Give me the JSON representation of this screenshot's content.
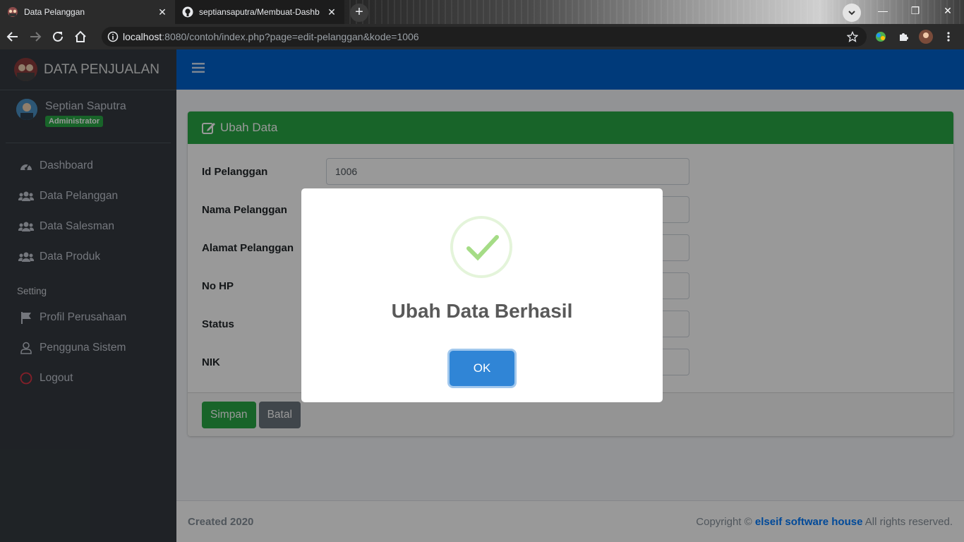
{
  "browser": {
    "tabs": [
      {
        "title": "Data Pelanggan",
        "active": true
      },
      {
        "title": "septiansaputra/Membuat-Dashb",
        "active": false
      }
    ],
    "url_host": "localhost",
    "url_rest": ":8080/contoh/index.php?page=edit-pelanggan&kode=1006"
  },
  "sidebar": {
    "brand": "DATA PENJUALAN",
    "user_name": "Septian Saputra",
    "user_role": "Administrator",
    "items": [
      {
        "label": "Dashboard",
        "icon": "tachometer-icon"
      },
      {
        "label": "Data Pelanggan",
        "icon": "users-icon"
      },
      {
        "label": "Data Salesman",
        "icon": "users-icon"
      },
      {
        "label": "Data Produk",
        "icon": "users-icon"
      }
    ],
    "section_header": "Setting",
    "settings": [
      {
        "label": "Profil Perusahaan",
        "icon": "flag-icon"
      },
      {
        "label": "Pengguna Sistem",
        "icon": "user-icon"
      },
      {
        "label": "Logout",
        "icon": "circle-icon"
      }
    ]
  },
  "card": {
    "title": "Ubah Data",
    "fields": [
      {
        "label": "Id Pelanggan",
        "value": "1006"
      },
      {
        "label": "Nama Pelanggan",
        "value": ""
      },
      {
        "label": "Alamat Pelanggan",
        "value": ""
      },
      {
        "label": "No HP",
        "value": ""
      },
      {
        "label": "Status",
        "value": ""
      },
      {
        "label": "NIK",
        "value": ""
      }
    ],
    "save_label": "Simpan",
    "cancel_label": "Batal"
  },
  "footer": {
    "left": "Created 2020",
    "copyright_prefix": "Copyright ©",
    "company": "elseif software house",
    "suffix": "All rights reserved."
  },
  "modal": {
    "title": "Ubah Data Berhasil",
    "ok_label": "OK",
    "ok_color": "#3085d6",
    "success_color": "#a5dc86"
  }
}
